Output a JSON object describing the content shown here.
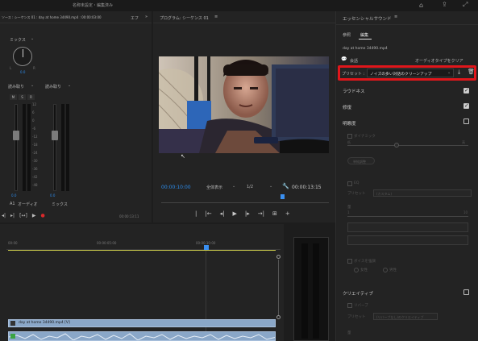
{
  "titlebar": {
    "title": "名称未設定・編集済み",
    "icons": [
      "home-icon",
      "share-icon",
      "fullscreen-icon"
    ]
  },
  "source_panel": {
    "title": "ソース : シーケンス 01 : day at home 34490.mp4 : 00:00:03:00",
    "tab_label": "エフ",
    "mix_label": "ミックス",
    "knob_left": "L",
    "knob_right": "R",
    "knob_value": "0.0",
    "ch1_mode": "読み取り",
    "ch2_mode": "読み取り",
    "solo_buttons": [
      "M",
      "S",
      "R"
    ],
    "meter_ticks": [
      "12",
      "6",
      "0",
      "-6",
      "-12",
      "-18",
      "-24",
      "-30",
      "-36",
      "-42",
      "-48",
      "dB"
    ],
    "ch1_value": "0.0",
    "ch2_value": "0.0",
    "a1_label": "A1",
    "audio_label": "オーディオ",
    "mix_footer": "ミックス",
    "timecode": "00:00:13:11"
  },
  "program_panel": {
    "title": "プログラム: シーケンス 01",
    "menu_icon": "≡",
    "current_time": "00:00:10:00",
    "fit_label": "全体表示",
    "res_label": "1/2",
    "duration": "00:00:13:15"
  },
  "essential_sound": {
    "title": "エッセンシャルサウンド",
    "tabs": [
      "参照",
      "編集"
    ],
    "active_tab": "編集",
    "clip_name": "day at home 34490.mp4",
    "dialogue_label": "会話",
    "clear_type_label": "オーディオタイプをクリア",
    "preset_label": "プリセット :",
    "preset_value": "ノイズの多い対話のクリーンアップ",
    "highlight_color": "#e0161b",
    "rows": [
      {
        "label": "ラウドネス",
        "checked": true
      },
      {
        "label": "修復",
        "checked": true
      },
      {
        "label": "明瞭度",
        "checked": false
      }
    ],
    "dim_dynamics": "ダイナミック",
    "dim_low": "低",
    "dim_high": "高",
    "dim_button": "単純調整",
    "dim_eq": "EQ",
    "dim_preset": "プリセット",
    "dim_preset_value": "(カスタム)",
    "dim_amount": "量",
    "dim_val_start": "1",
    "dim_val_end": "10",
    "dim_voice": "ボイスを強調",
    "dim_female": "女性",
    "dim_male": "男性",
    "creative_label": "クリエイティブ",
    "reverb_label": "リバーブ",
    "reverb_preset_label": "プリセット",
    "reverb_preset_value": "(リバーブなし)のクリエイティブ"
  },
  "timeline": {
    "ruler": [
      "00:00",
      "00:00:05:00",
      "00:00:10:00"
    ],
    "clip_name": "day at home 34490.mp4 [V]",
    "clip_color": "#8aa7c8",
    "audio_clip_color": "#8aa7c8"
  }
}
